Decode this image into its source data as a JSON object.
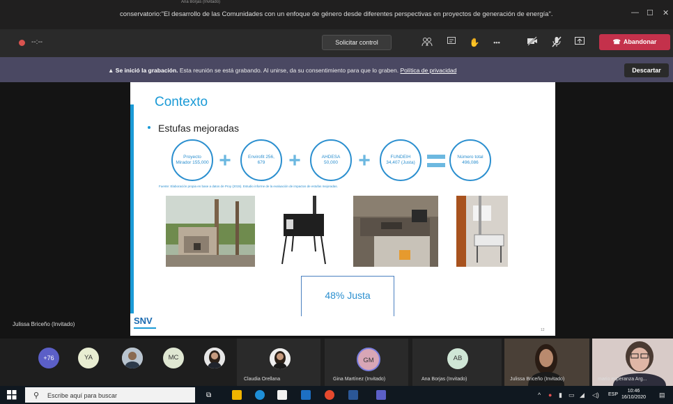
{
  "window": {
    "subtitle": "Ana Borjas (Invitado)",
    "title": "conservatorio:\"El desarrollo de las Comunidades con un enfoque de género desde diferentes perspectivas en proyectos de generación de energía\"."
  },
  "toolbar": {
    "elapsed": "--:--",
    "request_control": "Solicitar control",
    "more": "•••",
    "leave": "Abandonar"
  },
  "banner": {
    "bold": "Se inició la grabación.",
    "text": " Esta reunión se está grabando. Al unirse, da su consentimiento para que lo graben. ",
    "link": "Política de privacidad",
    "dismiss": "Descartar"
  },
  "slide": {
    "title": "Contexto",
    "bullet": "Estufas mejoradas",
    "circles": [
      {
        "text": "Proyecto Mirador 155,000"
      },
      {
        "text": "Envirofit 256, 679"
      },
      {
        "text": "AHDESA 50,000"
      },
      {
        "text": "FUNDEIH 34,407 (Justa)"
      },
      {
        "text": "Número total 496,086"
      }
    ],
    "source": "Fuente: Elaboración propia en base a datos de Proy (2015). Estudio informe de la evaluación de impactos de estufas mejoradas.",
    "callout": "48% Justa",
    "logo": "SNV",
    "page_number": "12"
  },
  "speaker_label": "Julissa Briceño (Invitado)",
  "participants": {
    "overflow": "+76",
    "avatars": [
      {
        "initials": "YA",
        "color": "#e8edd2"
      },
      {
        "initials": "MC",
        "color": "#dfe7d2"
      }
    ],
    "tiles": [
      {
        "name": "Claudia Orellana"
      },
      {
        "name": "Gina Martínez (Invitado)",
        "initials": "GM"
      },
      {
        "name": "Ana Borjas (Invitado)",
        "initials": "AB"
      },
      {
        "name": "Julissa Briceño (Invitado)"
      },
      {
        "name": "mario esperanza Arg..."
      }
    ]
  },
  "taskbar": {
    "search_placeholder": "Escribe aquí para buscar",
    "lang": "ESP",
    "time": "10:46",
    "date": "16/10/2020"
  }
}
